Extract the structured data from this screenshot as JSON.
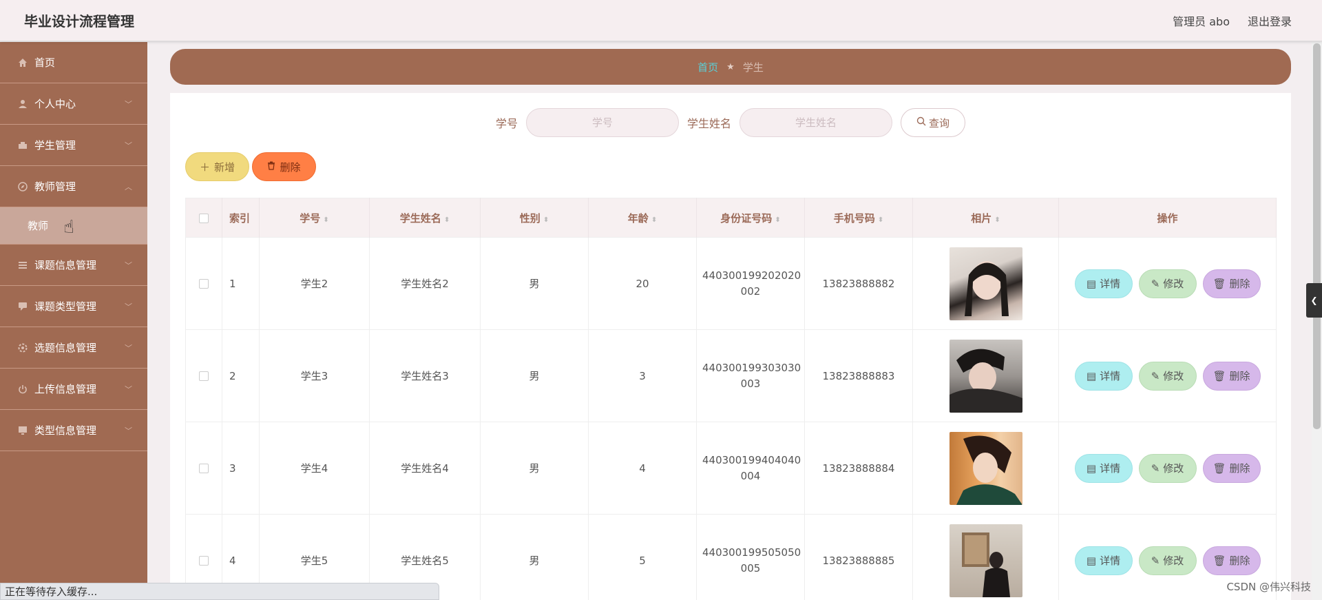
{
  "header": {
    "title": "毕业设计流程管理",
    "user_label": "管理员 abo",
    "logout_label": "退出登录"
  },
  "sidebar": {
    "items": [
      {
        "label": "首页",
        "icon": "home-icon"
      },
      {
        "label": "个人中心",
        "icon": "user-icon"
      },
      {
        "label": "学生管理",
        "icon": "student-icon"
      },
      {
        "label": "教师管理",
        "icon": "compass-icon",
        "expanded": true,
        "children": [
          {
            "label": "教师"
          }
        ]
      },
      {
        "label": "课题信息管理",
        "icon": "list-icon"
      },
      {
        "label": "课题类型管理",
        "icon": "comment-icon"
      },
      {
        "label": "选题信息管理",
        "icon": "gear-icon"
      },
      {
        "label": "上传信息管理",
        "icon": "power-icon"
      },
      {
        "label": "类型信息管理",
        "icon": "monitor-icon"
      }
    ]
  },
  "breadcrumb": {
    "home": "首页",
    "separator": "★",
    "current": "学生"
  },
  "search": {
    "student_id_label": "学号",
    "student_id_placeholder": "学号",
    "student_name_label": "学生姓名",
    "student_name_placeholder": "学生姓名",
    "query_label": "查询"
  },
  "actions": {
    "add_label": "新增",
    "delete_label": "删除"
  },
  "table": {
    "columns": [
      "索引",
      "学号",
      "学生姓名",
      "性别",
      "年龄",
      "身份证号码",
      "手机号码",
      "相片",
      "操作"
    ],
    "rows": [
      {
        "index": "1",
        "student_id": "学生2",
        "name": "学生姓名2",
        "gender": "男",
        "age": "20",
        "id_line1": "440300199202020",
        "id_line2": "002",
        "phone": "13823888882"
      },
      {
        "index": "2",
        "student_id": "学生3",
        "name": "学生姓名3",
        "gender": "男",
        "age": "3",
        "id_line1": "440300199303030",
        "id_line2": "003",
        "phone": "13823888883"
      },
      {
        "index": "3",
        "student_id": "学生4",
        "name": "学生姓名4",
        "gender": "男",
        "age": "4",
        "id_line1": "440300199404040",
        "id_line2": "004",
        "phone": "13823888884"
      },
      {
        "index": "4",
        "student_id": "学生5",
        "name": "学生姓名5",
        "gender": "男",
        "age": "5",
        "id_line1": "440300199505050",
        "id_line2": "005",
        "phone": "13823888885"
      }
    ],
    "row_actions": {
      "detail": "详情",
      "edit": "修改",
      "delete": "删除"
    }
  },
  "status_bar": "正在等待存入缓存...",
  "watermark": "CSDN @伟兴科技",
  "colors": {
    "sidebar_bg": "#a06a52",
    "header_bg": "#f6eef0",
    "accent_text": "#9b6a58",
    "breadcrumb_home": "#5ad0d8"
  }
}
